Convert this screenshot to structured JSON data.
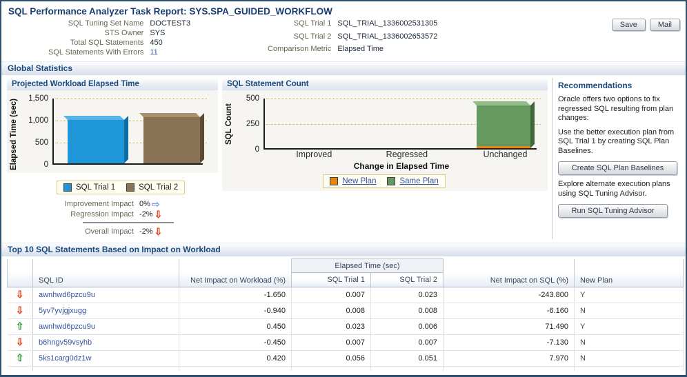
{
  "page": {
    "title": "SQL Performance Analyzer Task Report: SYS.SPA_GUIDED_WORKFLOW"
  },
  "toolbar": {
    "save_label": "Save",
    "mail_label": "Mail"
  },
  "summary": {
    "left": [
      {
        "label": "SQL Tuning Set Name",
        "value": "DOCTEST3"
      },
      {
        "label": "STS Owner",
        "value": "SYS"
      },
      {
        "label": "Total SQL Statements",
        "value": "450"
      },
      {
        "label": "SQL Statements With Errors",
        "value": "11"
      }
    ],
    "right": [
      {
        "label": "SQL Trial 1",
        "value": "SQL_TRIAL_1336002531305"
      },
      {
        "label": "SQL Trial 2",
        "value": "SQL_TRIAL_1336002653572"
      },
      {
        "label": "Comparison Metric",
        "value": "Elapsed Time"
      }
    ]
  },
  "sections": {
    "global_statistics": "Global Statistics",
    "top_sql": "Top 10 SQL Statements Based on Impact on Workload"
  },
  "icons": {
    "up": "⇧",
    "down": "⇩",
    "flat": "⇨"
  },
  "chart_data": [
    {
      "type": "bar",
      "title": "Projected Workload Elapsed Time",
      "ylabel": "Elapsed Time (sec)",
      "categories": [
        "SQL Trial 1",
        "SQL Trial 2"
      ],
      "values": [
        1010,
        1065
      ],
      "colors": [
        "#1e96d8",
        "#8a7355"
      ],
      "ylim": [
        0,
        1500
      ],
      "yticks": [
        "1,500",
        "1,000",
        "500",
        "0"
      ],
      "grid": "dotted-horizontal",
      "legend_position": "bottom"
    },
    {
      "type": "stacked-bar",
      "title": "SQL Statement Count",
      "ylabel": "SQL Count",
      "xlabel": "Change in Elapsed Time",
      "categories": [
        "Improved",
        "Regressed",
        "Unchanged"
      ],
      "series": [
        {
          "name": "New Plan",
          "color": "#e8860c",
          "values": [
            0,
            0,
            8
          ]
        },
        {
          "name": "Same Plan",
          "color": "#66985f",
          "values": [
            0,
            0,
            428
          ]
        }
      ],
      "ylim": [
        0,
        500
      ],
      "yticks": [
        "500",
        "250",
        "0"
      ],
      "grid": "dotted-horizontal",
      "legend_position": "bottom"
    }
  ],
  "impact": {
    "rows": [
      {
        "label": "Improvement Impact",
        "value": "0%",
        "dir": "flat"
      },
      {
        "label": "Regression Impact",
        "value": "-2%",
        "dir": "down"
      }
    ],
    "overall": {
      "label": "Overall Impact",
      "value": "-2%",
      "dir": "down"
    }
  },
  "recommendations": {
    "title": "Recommendations",
    "intro": "Oracle offers two options to fix regressed SQL resulting from plan changes:",
    "baseline_text": "Use the better execution plan from SQL Trial 1 by creating SQL Plan Baselines.",
    "baseline_button": "Create SQL Plan Baselines",
    "advisor_text": "Explore alternate execution plans using SQL Tuning Advisor.",
    "advisor_button": "Run SQL Tuning Advisor"
  },
  "table": {
    "group_header": "Elapsed Time (sec)",
    "columns": [
      "SQL ID",
      "Net Impact on Workload (%)",
      "SQL Trial 1",
      "SQL Trial 2",
      "Net Impact on SQL (%)",
      "New Plan"
    ],
    "rows": [
      {
        "trend": "down",
        "sql_id": "awnhwd6pzcu9u",
        "net_workload": "-1.650",
        "trial1": "0.007",
        "trial2": "0.023",
        "net_sql": "-243.800",
        "new_plan": "Y"
      },
      {
        "trend": "down",
        "sql_id": "5yv7yvjgjxugg",
        "net_workload": "-0.940",
        "trial1": "0.008",
        "trial2": "0.008",
        "net_sql": "-6.160",
        "new_plan": "N"
      },
      {
        "trend": "up",
        "sql_id": "awnhwd6pzcu9u",
        "net_workload": "0.450",
        "trial1": "0.023",
        "trial2": "0.006",
        "net_sql": "71.490",
        "new_plan": "Y"
      },
      {
        "trend": "down",
        "sql_id": "b6hngv59vsyhb",
        "net_workload": "-0.450",
        "trial1": "0.007",
        "trial2": "0.007",
        "net_sql": "-7.130",
        "new_plan": "N"
      },
      {
        "trend": "up",
        "sql_id": "5ks1carg0dz1w",
        "net_workload": "0.420",
        "trial1": "0.056",
        "trial2": "0.051",
        "net_sql": "7.970",
        "new_plan": "N"
      }
    ]
  }
}
